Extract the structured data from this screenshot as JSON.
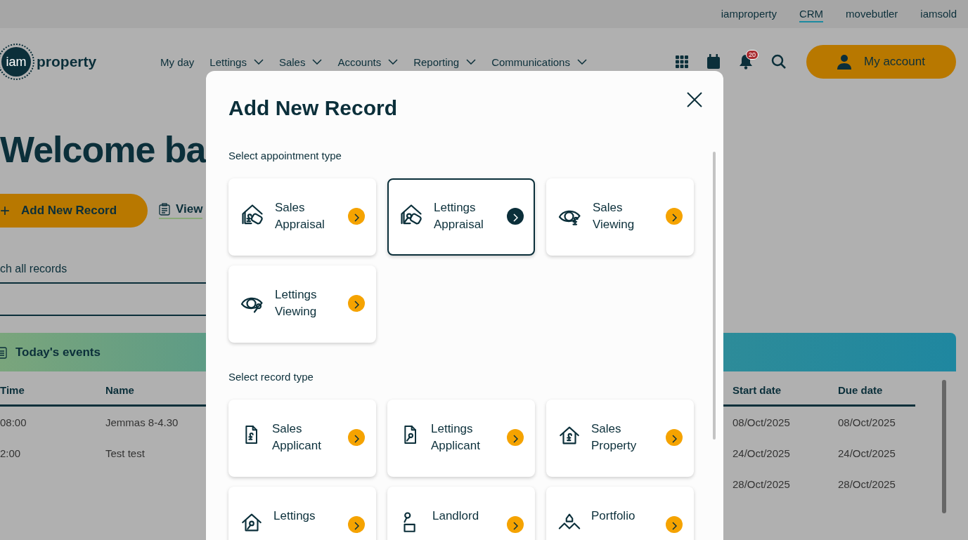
{
  "top_links": [
    {
      "label": "iamproperty",
      "selected": false
    },
    {
      "label": "CRM",
      "selected": true
    },
    {
      "label": "movebutler",
      "selected": false
    },
    {
      "label": "iamsold",
      "selected": false
    }
  ],
  "logo": {
    "mark": "iam",
    "word": "property"
  },
  "nav": [
    {
      "label": "My day",
      "dropdown": false
    },
    {
      "label": "Lettings",
      "dropdown": true
    },
    {
      "label": "Sales",
      "dropdown": true
    },
    {
      "label": "Accounts",
      "dropdown": true
    },
    {
      "label": "Reporting",
      "dropdown": true
    },
    {
      "label": "Communications",
      "dropdown": true
    }
  ],
  "notification_count": "20",
  "account_button": "My account",
  "welcome": "Welcome ba",
  "add_button": {
    "icon": "+",
    "label": "Add New Record"
  },
  "view_link": "View",
  "search_label": "ch all records",
  "events": {
    "title": "Today's events",
    "columns": [
      "Time",
      "Name",
      "Start date",
      "Due date"
    ],
    "rows": [
      {
        "time": "08:00",
        "name": "Jemmas 8-4.30",
        "start": "08/Oct/2025",
        "due": "08/Oct/2025"
      },
      {
        "time": "2:00",
        "name": "Test test",
        "start": "24/Oct/2025",
        "due": "24/Oct/2025"
      },
      {
        "start": "28/Oct/2025",
        "due": "28/Oct/2025"
      }
    ]
  },
  "modal": {
    "title": "Add New Record",
    "sections": [
      {
        "label": "Select appointment type",
        "cards": [
          {
            "lines": [
              "Sales",
              "Appraisal"
            ],
            "selected": false
          },
          {
            "lines": [
              "Lettings",
              "Appraisal"
            ],
            "selected": true
          },
          {
            "lines": [
              "Sales",
              "Viewing"
            ],
            "selected": false
          },
          {
            "lines": [
              "Lettings",
              "Viewing"
            ],
            "selected": false
          }
        ]
      },
      {
        "label": "Select record type",
        "cards": [
          {
            "lines": [
              "Sales",
              "Applicant"
            ],
            "selected": false
          },
          {
            "lines": [
              "Lettings",
              "Applicant"
            ],
            "selected": false
          },
          {
            "lines": [
              "Sales",
              "Property"
            ],
            "selected": false
          },
          {
            "lines": [
              "Lettings"
            ],
            "selected": false
          },
          {
            "lines": [
              "Landlord"
            ],
            "selected": false
          },
          {
            "lines": [
              "Portfolio"
            ],
            "selected": false
          }
        ]
      }
    ]
  }
}
